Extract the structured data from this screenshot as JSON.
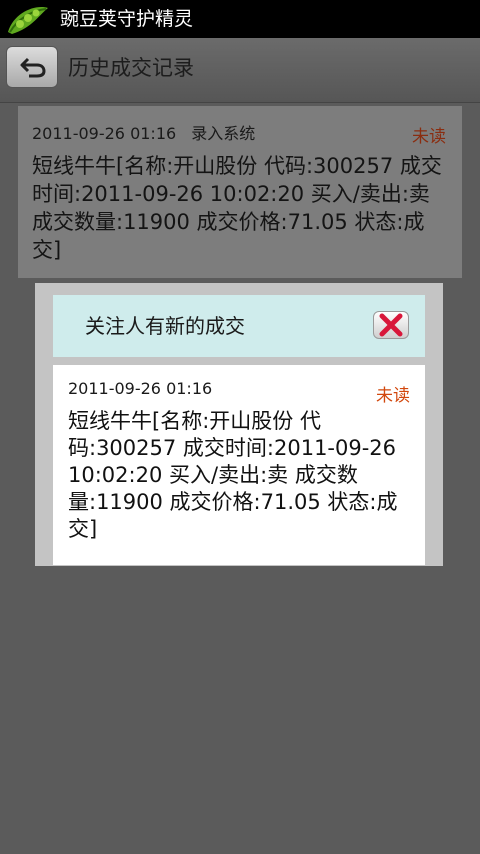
{
  "statusbar": {
    "app_title": "豌豆荚守护精灵",
    "logo_icon": "pea-pod-icon"
  },
  "header": {
    "back_icon": "undo-arrow-icon",
    "title": "历史成交记录"
  },
  "record": {
    "datetime": "2011-09-26 01:16",
    "source": "录入系统",
    "status": "未读",
    "content": "短线牛牛[名称:开山股份 代码:300257 成交时间:2011-09-26 10:02:20 买入/卖出:卖 成交数量:11900 成交价格:71.05 状态:成交]"
  },
  "dialog": {
    "title": "关注人有新的成交",
    "close_icon": "close-x-icon",
    "datetime": "2011-09-26 01:16",
    "status": "未读",
    "content": "短线牛牛[名称:开山股份 代码:300257 成交时间:2011-09-26 10:02:20 买入/卖出:卖 成交数量:11900 成交价格:71.05 状态:成交]"
  },
  "colors": {
    "unread_text": "#d2470d",
    "dialog_header": "#cfecec",
    "background": "#5b5b5b"
  }
}
